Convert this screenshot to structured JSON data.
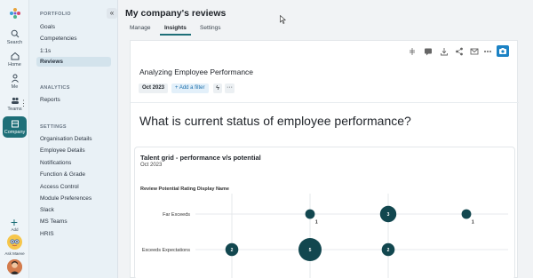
{
  "rail": {
    "items": [
      {
        "label": "Search",
        "icon": "search-icon"
      },
      {
        "label": "Home",
        "icon": "home-icon"
      },
      {
        "label": "Me",
        "icon": "person-icon"
      },
      {
        "label": "Teams",
        "icon": "teams-icon"
      },
      {
        "label": "Company",
        "icon": "company-icon"
      }
    ],
    "add_label": "Add",
    "bot_label": "Ask Maeve"
  },
  "sidebar": {
    "portfolio_heading": "PORTFOLIO",
    "portfolio_items": [
      "Goals",
      "Competencies",
      "1:1s",
      "Reviews"
    ],
    "analytics_heading": "ANALYTICS",
    "analytics_items": [
      "Reports"
    ],
    "settings_heading": "SETTINGS",
    "settings_items": [
      "Organisation Details",
      "Employee Details",
      "Notifications",
      "Function & Grade",
      "Access Control",
      "Module Preferences",
      "Slack",
      "MS Teams",
      "HRIS"
    ]
  },
  "header": {
    "title": "My company's reviews",
    "tabs": [
      "Manage",
      "Insights",
      "Settings"
    ],
    "active_tab": "Insights"
  },
  "report": {
    "title": "Analyzing Employee Performance",
    "date_chip": "Oct 2023",
    "add_filter": "+ Add a filter",
    "question": "What is current status of employee performance?"
  },
  "colors": {
    "accent": "#1e6f78",
    "bubble": "#12474f",
    "camera": "#1c82c4"
  },
  "chart_data": {
    "type": "scatter",
    "title": "Talent grid - performance v/s potential",
    "subtitle": "Oct 2023",
    "ylabel": "Review Potential Rating Display Name",
    "y_categories": [
      "Far Exceeds",
      "Exceeds Expectations"
    ],
    "points": [
      {
        "x": 2,
        "y": "Far Exceeds",
        "value": 1
      },
      {
        "x": 3,
        "y": "Far Exceeds",
        "value": 3
      },
      {
        "x": 4,
        "y": "Far Exceeds",
        "value": 1
      },
      {
        "x": 1,
        "y": "Exceeds Expectations",
        "value": 2
      },
      {
        "x": 2,
        "y": "Exceeds Expectations",
        "value": 5
      },
      {
        "x": 3,
        "y": "Exceeds Expectations",
        "value": 2
      }
    ]
  }
}
